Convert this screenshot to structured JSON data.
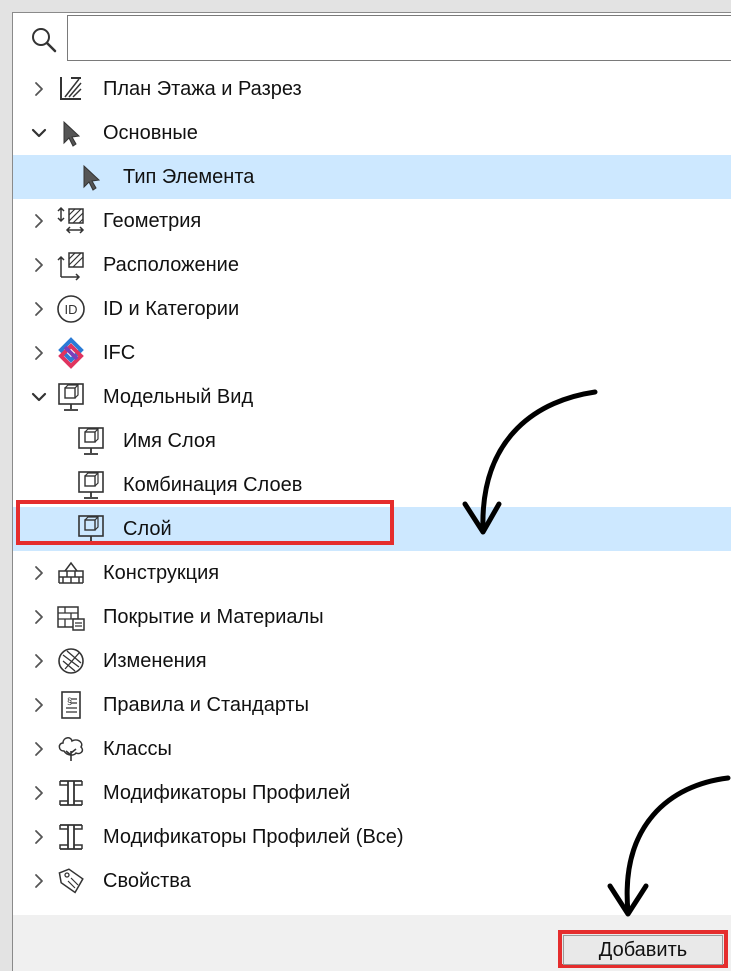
{
  "search": {
    "value": "",
    "placeholder": ""
  },
  "tree": [
    {
      "label": "План Этажа и Разрез",
      "icon": "floorplan-section-icon",
      "expanded": false,
      "level": 0
    },
    {
      "label": "Основные",
      "icon": "pointer-arrow-icon",
      "expanded": true,
      "level": 0
    },
    {
      "label": "Тип Элемента",
      "icon": "pointer-arrow-icon",
      "level": 1,
      "selected": true
    },
    {
      "label": "Геометрия",
      "icon": "geometry-icon",
      "expanded": false,
      "level": 0
    },
    {
      "label": "Расположение",
      "icon": "positioning-icon",
      "expanded": false,
      "level": 0
    },
    {
      "label": "ID и Категории",
      "icon": "id-circle-icon",
      "expanded": false,
      "level": 0
    },
    {
      "label": "IFC",
      "icon": "ifc-logo-icon",
      "expanded": false,
      "level": 0
    },
    {
      "label": "Модельный Вид",
      "icon": "model-view-icon",
      "expanded": true,
      "level": 0
    },
    {
      "label": "Имя Слоя",
      "icon": "model-view-icon",
      "level": 1
    },
    {
      "label": "Комбинация Слоев",
      "icon": "model-view-icon",
      "level": 1
    },
    {
      "label": "Слой",
      "icon": "model-view-icon",
      "level": 1,
      "selected": true
    },
    {
      "label": "Конструкция",
      "icon": "structure-icon",
      "expanded": false,
      "level": 0
    },
    {
      "label": "Покрытие и Материалы",
      "icon": "materials-icon",
      "expanded": false,
      "level": 0
    },
    {
      "label": "Изменения",
      "icon": "changes-icon",
      "expanded": false,
      "level": 0
    },
    {
      "label": "Правила и Стандарты",
      "icon": "rules-document-icon",
      "expanded": false,
      "level": 0
    },
    {
      "label": "Классы",
      "icon": "classes-tree-icon",
      "expanded": false,
      "level": 0
    },
    {
      "label": "Модификаторы Профилей",
      "icon": "profile-i-beam-icon",
      "expanded": false,
      "level": 0
    },
    {
      "label": "Модификаторы Профилей (Все)",
      "icon": "profile-i-beam-icon",
      "expanded": false,
      "level": 0
    },
    {
      "label": "Свойства",
      "icon": "properties-tag-icon",
      "expanded": false,
      "level": 0
    }
  ],
  "footer": {
    "add_label": "Добавить"
  },
  "colors": {
    "selection": "#cde8ff",
    "annotation_red": "#e52d2d",
    "panel_bg": "#ffffff",
    "window_bg": "#f0f0f0"
  }
}
